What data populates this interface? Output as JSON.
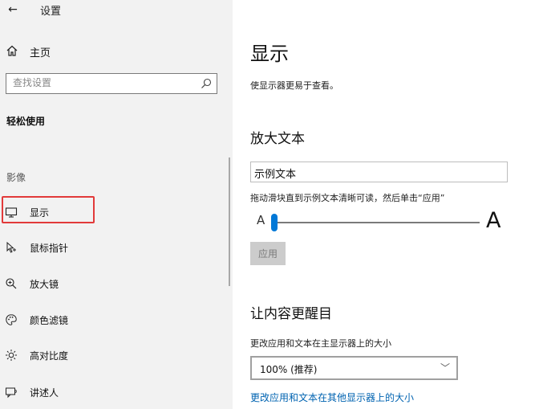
{
  "window": {
    "title": "设置"
  },
  "sidebar": {
    "home_label": "主页",
    "search_placeholder": "查找设置",
    "section_heading": "轻松使用",
    "group_label": "影像",
    "items": [
      {
        "label": "显示",
        "icon": "monitor-icon",
        "selected": true
      },
      {
        "label": "鼠标指针",
        "icon": "mouse-pointer-icon"
      },
      {
        "label": "放大镜",
        "icon": "magnifier-icon"
      },
      {
        "label": "颜色滤镜",
        "icon": "color-palette-icon"
      },
      {
        "label": "高对比度",
        "icon": "brightness-icon"
      },
      {
        "label": "讲述人",
        "icon": "narrator-icon"
      }
    ]
  },
  "main": {
    "title": "显示",
    "description": "使显示器更易于查看。",
    "enlarge_text": {
      "heading": "放大文本",
      "sample_text": "示例文本",
      "instruction": "拖动滑块直到示例文本清晰可读，然后单击“应用”",
      "small_a": "A",
      "large_a": "A",
      "slider_value": 0.0,
      "apply_label": "应用"
    },
    "make_prominent": {
      "heading": "让内容更醒目",
      "scale_label": "更改应用和文本在主显示器上的大小",
      "scale_value": "100% (推荐)",
      "other_displays_link": "更改应用和文本在其他显示器上的大小"
    }
  },
  "colors": {
    "sidebar_bg": "#f2f2f2",
    "accent": "#0078d7",
    "highlight_outline": "#e23a3a",
    "link": "#0063b1"
  }
}
